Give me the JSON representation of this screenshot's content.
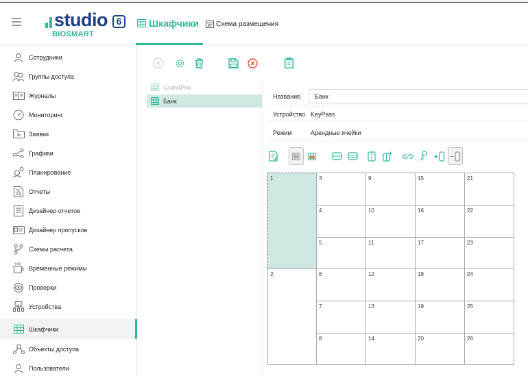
{
  "app": {
    "brand_word": "studio",
    "brand_version": "6",
    "brand_sub": "BIOSMART",
    "brand_color": "#1d3f86",
    "accent_color": "#2db89a"
  },
  "header": {
    "tab_main": "Шкафчики",
    "tab_sub": "Схема размещения"
  },
  "sidebar": {
    "items": [
      {
        "label": "Сотрудники",
        "icon": "person-icon"
      },
      {
        "label": "Группы доступа",
        "icon": "group-icon"
      },
      {
        "label": "Журналы",
        "icon": "journal-icon"
      },
      {
        "label": "Мониторинг",
        "icon": "gauge-icon"
      },
      {
        "label": "Заявки",
        "icon": "folder-plus-icon"
      },
      {
        "label": "Графики",
        "icon": "share-icon"
      },
      {
        "label": "Планирование",
        "icon": "planning-icon"
      },
      {
        "label": "Отчеты",
        "icon": "report-icon"
      },
      {
        "label": "Дизайнер отчетов",
        "icon": "report-designer-icon"
      },
      {
        "label": "Дизайнер пропусков",
        "icon": "id-card-icon"
      },
      {
        "label": "Схемы расчета",
        "icon": "branch-icon"
      },
      {
        "label": "Временные режимы",
        "icon": "cup-icon"
      },
      {
        "label": "Проверки",
        "icon": "eye-icon"
      },
      {
        "label": "Устройства",
        "icon": "devices-icon"
      },
      {
        "label": "Шкафчики",
        "icon": "lockers-icon"
      },
      {
        "label": "Объекты доступа",
        "icon": "objects-icon"
      },
      {
        "label": "Пользователи",
        "icon": "user-icon"
      }
    ],
    "active_index": 14
  },
  "tree": {
    "items": [
      {
        "label": "GrandPrix",
        "selected": false
      },
      {
        "label": "Банк",
        "selected": true
      }
    ]
  },
  "form": {
    "name_label": "Название",
    "name_value": "Банк",
    "device_label": "Устройство",
    "device_value": "KeyPass",
    "mode_label": "Режим",
    "mode_value": "Арендные ячейки"
  },
  "grid": {
    "cells": [
      "1",
      "2",
      "3",
      "4",
      "5",
      "6",
      "7",
      "8",
      "9",
      "10",
      "11",
      "12",
      "13",
      "14",
      "15",
      "16",
      "17",
      "18",
      "19",
      "20",
      "21",
      "22",
      "23",
      "24",
      "25",
      "26"
    ],
    "selected": "1"
  }
}
